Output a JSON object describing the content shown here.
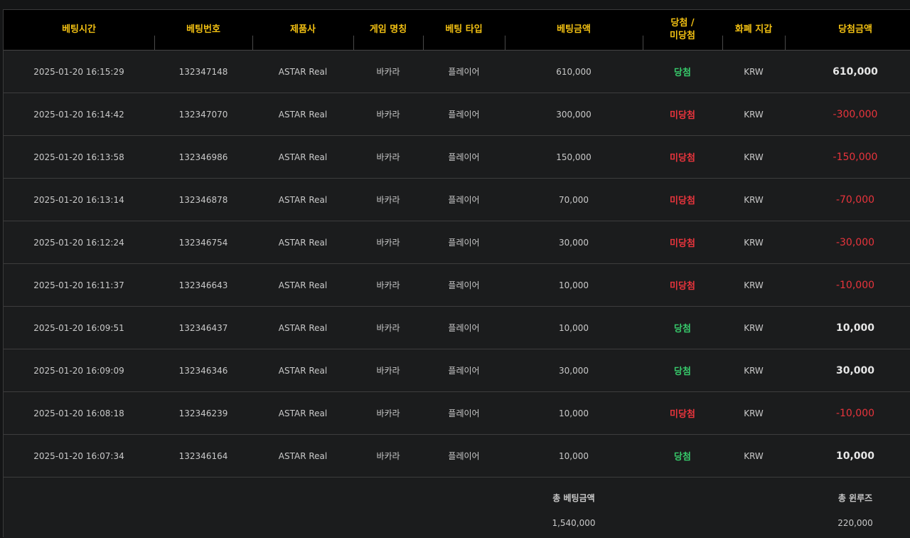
{
  "colors": {
    "header_text": "#f2c012",
    "win": "#37c86a",
    "lose": "#e8343c",
    "text": "#c9c9c9",
    "win_amount": "#e6e6e6"
  },
  "columns": [
    {
      "key": "time",
      "label": "베팅시간",
      "label2": ""
    },
    {
      "key": "bet_no",
      "label": "베팅번호",
      "label2": ""
    },
    {
      "key": "provider",
      "label": "제품사",
      "label2": ""
    },
    {
      "key": "game",
      "label": "게임 명칭",
      "label2": ""
    },
    {
      "key": "bet_type",
      "label": "베팅 타입",
      "label2": ""
    },
    {
      "key": "bet_amount",
      "label": "베팅금액",
      "label2": ""
    },
    {
      "key": "result",
      "label": "당첨 /",
      "label2": "미당첨"
    },
    {
      "key": "currency",
      "label": "화폐 지갑",
      "label2": ""
    },
    {
      "key": "win_amount",
      "label": "당첨금액",
      "label2": ""
    }
  ],
  "rows": [
    {
      "time": "2025-01-20 16:15:29",
      "bet_no": "132347148",
      "provider": "ASTAR Real",
      "game": "바카라",
      "bet_type": "플레이어",
      "bet_amount": "610,000",
      "result": "당첨",
      "win": true,
      "currency": "KRW",
      "win_amount": "610,000"
    },
    {
      "time": "2025-01-20 16:14:42",
      "bet_no": "132347070",
      "provider": "ASTAR Real",
      "game": "바카라",
      "bet_type": "플레이어",
      "bet_amount": "300,000",
      "result": "미당첨",
      "win": false,
      "currency": "KRW",
      "win_amount": "-300,000"
    },
    {
      "time": "2025-01-20 16:13:58",
      "bet_no": "132346986",
      "provider": "ASTAR Real",
      "game": "바카라",
      "bet_type": "플레이어",
      "bet_amount": "150,000",
      "result": "미당첨",
      "win": false,
      "currency": "KRW",
      "win_amount": "-150,000"
    },
    {
      "time": "2025-01-20 16:13:14",
      "bet_no": "132346878",
      "provider": "ASTAR Real",
      "game": "바카라",
      "bet_type": "플레이어",
      "bet_amount": "70,000",
      "result": "미당첨",
      "win": false,
      "currency": "KRW",
      "win_amount": "-70,000"
    },
    {
      "time": "2025-01-20 16:12:24",
      "bet_no": "132346754",
      "provider": "ASTAR Real",
      "game": "바카라",
      "bet_type": "플레이어",
      "bet_amount": "30,000",
      "result": "미당첨",
      "win": false,
      "currency": "KRW",
      "win_amount": "-30,000"
    },
    {
      "time": "2025-01-20 16:11:37",
      "bet_no": "132346643",
      "provider": "ASTAR Real",
      "game": "바카라",
      "bet_type": "플레이어",
      "bet_amount": "10,000",
      "result": "미당첨",
      "win": false,
      "currency": "KRW",
      "win_amount": "-10,000"
    },
    {
      "time": "2025-01-20 16:09:51",
      "bet_no": "132346437",
      "provider": "ASTAR Real",
      "game": "바카라",
      "bet_type": "플레이어",
      "bet_amount": "10,000",
      "result": "당첨",
      "win": true,
      "currency": "KRW",
      "win_amount": "10,000"
    },
    {
      "time": "2025-01-20 16:09:09",
      "bet_no": "132346346",
      "provider": "ASTAR Real",
      "game": "바카라",
      "bet_type": "플레이어",
      "bet_amount": "30,000",
      "result": "당첨",
      "win": true,
      "currency": "KRW",
      "win_amount": "30,000"
    },
    {
      "time": "2025-01-20 16:08:18",
      "bet_no": "132346239",
      "provider": "ASTAR Real",
      "game": "바카라",
      "bet_type": "플레이어",
      "bet_amount": "10,000",
      "result": "미당첨",
      "win": false,
      "currency": "KRW",
      "win_amount": "-10,000"
    },
    {
      "time": "2025-01-20 16:07:34",
      "bet_no": "132346164",
      "provider": "ASTAR Real",
      "game": "바카라",
      "bet_type": "플레이어",
      "bet_amount": "10,000",
      "result": "당첨",
      "win": true,
      "currency": "KRW",
      "win_amount": "10,000"
    }
  ],
  "footer": {
    "total_bet_label": "총 베팅금액",
    "total_bet_value": "1,540,000",
    "total_winloss_label": "총 윈루즈",
    "total_winloss_value": "220,000"
  }
}
